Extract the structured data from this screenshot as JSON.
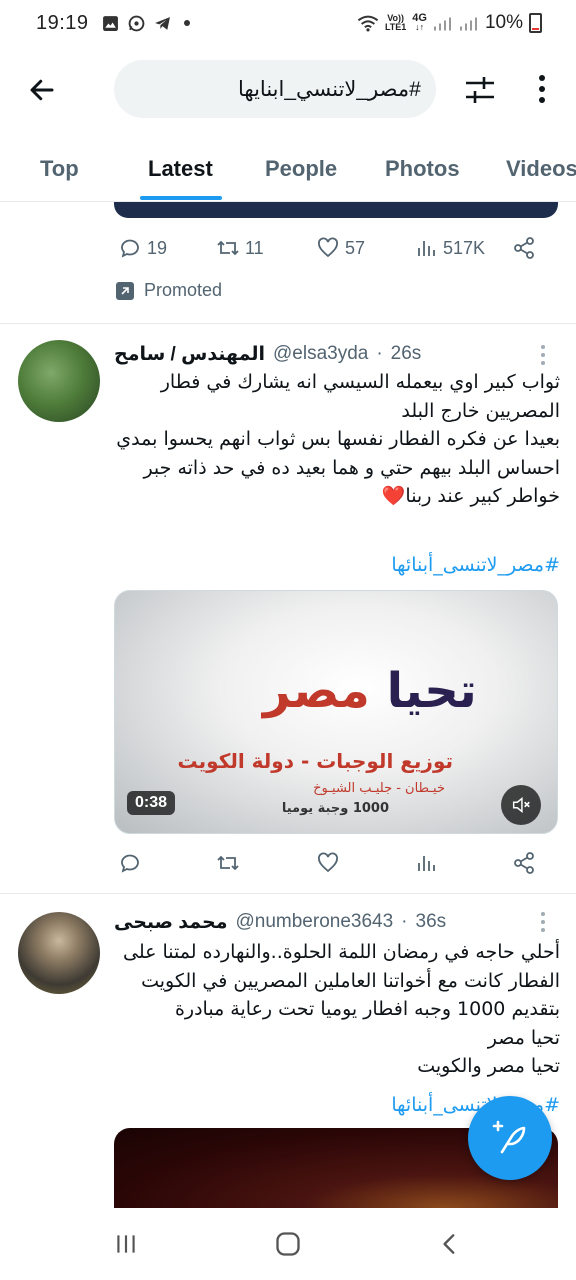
{
  "status_bar": {
    "time": "19:19",
    "network_label": "4G",
    "volte_label_top": "Vo))",
    "volte_label_bottom": "LTE1",
    "battery": "10%"
  },
  "header": {
    "back_icon": "arrow-left-icon",
    "search_query": "#مصر_لاتنسي_ابنايها",
    "filter_icon": "sliders-icon",
    "more_icon": "more-vertical-icon"
  },
  "tabs": [
    {
      "label": "Top",
      "active": false
    },
    {
      "label": "Latest",
      "active": true
    },
    {
      "label": "People",
      "active": false
    },
    {
      "label": "Photos",
      "active": false
    },
    {
      "label": "Videos",
      "active": false
    }
  ],
  "promoted_tweet": {
    "replies": "19",
    "retweets": "11",
    "likes": "57",
    "views": "517K",
    "promoted_label": "Promoted"
  },
  "tweets": [
    {
      "name": "المهندس / سامح",
      "handle": "@elsa3yda",
      "time": "26s",
      "lines": [
        "ثواب كبير اوي بيعمله السيسي انه يشارك في فطار",
        "المصريين خارج البلد",
        "بعيدا عن فكره الفطار نفسها بس ثواب انهم يحسوا بمدي",
        "احساس البلد بيهم حتي و هما بعيد ده في حد ذاته جبر",
        "خواطر كبير عند ربنا❤️"
      ],
      "hashtag": "#مصر_لاتنسى_أبنائها",
      "video": {
        "logo_main": "تحيا ",
        "logo_accent": "مصر",
        "line1": "توزيع الوجبات - دولة الكويت",
        "line2": "خيـطان - جليـب الشيـوخ",
        "line3": "1000 وجبة يوميا",
        "duration": "0:38"
      }
    },
    {
      "name": "محمد صبحى",
      "handle": "@numberone3643",
      "time": "36s",
      "lines": [
        "أحلي حاجه في رمضان اللمة الحلوة..والنهارده لمتنا على",
        "الفطار كانت مع أخواتنا العاملين المصريين في الكويت",
        "بتقديم  1000 وجبه افطار يوميا تحت رعاية مبادرة",
        "تحيا مصر",
        "تحيا مصر والكويت"
      ],
      "hashtag": "#مصر_لاتنسى_أبنائها"
    }
  ],
  "colors": {
    "accent": "#1d9bf0",
    "text_primary": "#0f1419",
    "text_secondary": "#536471",
    "divider": "#e7e9ea"
  }
}
